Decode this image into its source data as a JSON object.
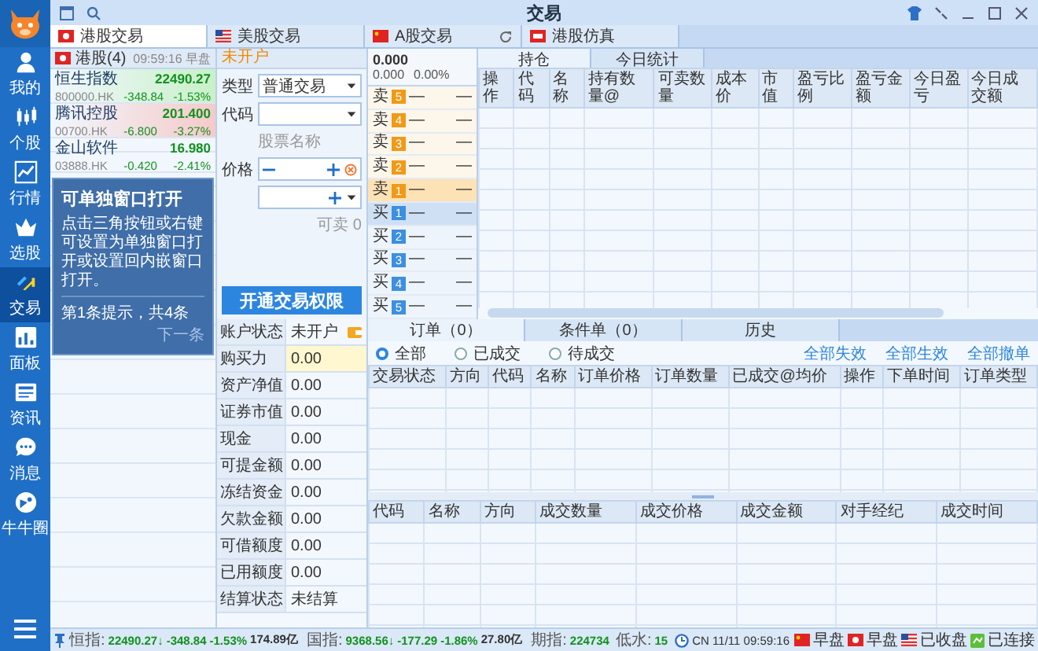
{
  "window": {
    "title": "交易"
  },
  "nav": {
    "items": [
      {
        "kind": "person",
        "label": "我的",
        "selected": false
      },
      {
        "kind": "candles",
        "label": "个股",
        "selected": false
      },
      {
        "kind": "chart",
        "label": "行情",
        "selected": false
      },
      {
        "kind": "crown",
        "label": "选股",
        "selected": false
      },
      {
        "kind": "trade",
        "label": "交易",
        "selected": true
      },
      {
        "kind": "panel",
        "label": "面板",
        "selected": false
      },
      {
        "kind": "news",
        "label": "资讯",
        "selected": false
      },
      {
        "kind": "message",
        "label": "消息",
        "selected": false
      },
      {
        "kind": "community",
        "label": "牛牛圈",
        "selected": false
      }
    ]
  },
  "market_tabs": [
    {
      "kind": "hk",
      "label": "港股交易",
      "selected": true,
      "refresh": false
    },
    {
      "kind": "us",
      "label": "美股交易",
      "selected": false,
      "refresh": false
    },
    {
      "kind": "cn",
      "label": "A股交易",
      "selected": false,
      "refresh": true
    },
    {
      "kind": "sim",
      "label": "港股仿真",
      "selected": false,
      "refresh": false
    }
  ],
  "watchlist": {
    "title": "港股(4)",
    "time": "09:59:16 早盘",
    "rows": [
      {
        "name": "恒生指数",
        "code": "800000.HK",
        "price": "22490.27",
        "change": "-348.84",
        "percent": "-1.53%",
        "color": "#c9f0c9"
      },
      {
        "name": "腾讯控股",
        "code": "00700.HK",
        "price": "201.400",
        "change": "-6.800",
        "percent": "-3.27%",
        "color": "#f5caca"
      },
      {
        "name": "金山软件",
        "code": "03888.HK",
        "price": "16.980",
        "change": "-0.420",
        "percent": "-2.41%"
      }
    ]
  },
  "tooltip": {
    "title": "可单独窗口打开",
    "body": "点击三角按钮或右键可设置为单独窗口打开或设置回内嵌窗口打开。",
    "progress": "第1条提示，共4条",
    "next": "下一条"
  },
  "trade_form": {
    "status": "未开户",
    "type": {
      "label": "类型",
      "value": "普通交易"
    },
    "code": {
      "label": "代码"
    },
    "stock_name": "股票名称",
    "price": {
      "label": "价格"
    },
    "sellable": "可卖 0",
    "button": "开通交易权限"
  },
  "account": {
    "rows": [
      {
        "label": "账户状态",
        "value": "未开户",
        "highlight": false,
        "has_icon": true
      },
      {
        "label": "购买力",
        "value": "0.00",
        "highlight": true,
        "has_icon": false
      },
      {
        "label": "资产净值",
        "value": "0.00",
        "highlight": false,
        "has_icon": false
      },
      {
        "label": "证券市值",
        "value": "0.00",
        "highlight": false,
        "has_icon": false
      },
      {
        "label": "现金",
        "value": "0.00",
        "highlight": false,
        "has_icon": false
      },
      {
        "label": "可提金额",
        "value": "0.00",
        "highlight": false,
        "has_icon": false
      },
      {
        "label": "冻结资金",
        "value": "0.00",
        "highlight": false,
        "has_icon": false
      },
      {
        "label": "欠款金额",
        "value": "0.00",
        "highlight": false,
        "has_icon": false
      },
      {
        "label": "可借额度",
        "value": "0.00",
        "highlight": false,
        "has_icon": false
      },
      {
        "label": "已用额度",
        "value": "0.00",
        "highlight": false,
        "has_icon": false
      },
      {
        "label": "结算状态",
        "value": "未结算",
        "highlight": false,
        "has_icon": false
      }
    ]
  },
  "order_book": {
    "price": "0.000",
    "change": "0.000",
    "percent": "0.00%",
    "levels": [
      {
        "kind": "sell",
        "label": "卖",
        "rank": "5",
        "price": "—",
        "volume": "—",
        "highlight": false
      },
      {
        "kind": "sell",
        "label": "卖",
        "rank": "4",
        "price": "—",
        "volume": "—",
        "highlight": false
      },
      {
        "kind": "sell",
        "label": "卖",
        "rank": "3",
        "price": "—",
        "volume": "—",
        "highlight": false
      },
      {
        "kind": "sell",
        "label": "卖",
        "rank": "2",
        "price": "—",
        "volume": "—",
        "highlight": false
      },
      {
        "kind": "sell",
        "label": "卖",
        "rank": "1",
        "price": "—",
        "volume": "—",
        "highlight": true
      },
      {
        "kind": "buy",
        "label": "买",
        "rank": "1",
        "price": "—",
        "volume": "—",
        "highlight": true
      },
      {
        "kind": "buy",
        "label": "买",
        "rank": "2",
        "price": "—",
        "volume": "—",
        "highlight": false
      },
      {
        "kind": "buy",
        "label": "买",
        "rank": "3",
        "price": "—",
        "volume": "—",
        "highlight": false
      },
      {
        "kind": "buy",
        "label": "买",
        "rank": "4",
        "price": "—",
        "volume": "—",
        "highlight": false
      },
      {
        "kind": "buy",
        "label": "买",
        "rank": "5",
        "price": "—",
        "volume": "—",
        "highlight": false
      }
    ]
  },
  "positions": {
    "tabs": [
      {
        "label": "持仓",
        "selected": true
      },
      {
        "label": "今日统计",
        "selected": false
      }
    ],
    "columns": [
      "操作",
      "代码",
      "名称",
      "持有数量@",
      "可卖数量",
      "成本价",
      "市值",
      "盈亏比例",
      "盈亏金额",
      "今日盈亏",
      "今日成交额"
    ]
  },
  "orders": {
    "tabs": [
      {
        "label": "订单（0）",
        "selected": true
      },
      {
        "label": "条件单（0）",
        "selected": false
      },
      {
        "label": "历史",
        "selected": false
      }
    ],
    "filters": [
      {
        "label": "全部",
        "selected": true
      },
      {
        "label": "已成交",
        "selected": false
      },
      {
        "label": "待成交",
        "selected": false
      }
    ],
    "actions": [
      "全部失效",
      "全部生效",
      "全部撤单"
    ],
    "columns": [
      "交易状态",
      "方向",
      "代码",
      "名称",
      "订单价格",
      "订单数量",
      "已成交@均价",
      "操作",
      "下单时间",
      "订单类型"
    ]
  },
  "trades": {
    "columns": [
      "代码",
      "名称",
      "方向",
      "成交数量",
      "成交价格",
      "成交金额",
      "对手经纪",
      "成交时间"
    ]
  },
  "status_bar": {
    "indices": [
      {
        "label": "恒指:",
        "value": "22490.27↓",
        "change": "-348.84",
        "percent": "-1.53%",
        "turnover": "174.89亿"
      },
      {
        "label": "国指:",
        "value": "9368.56↓",
        "change": "-177.29",
        "percent": "-1.86%",
        "turnover": "27.80亿"
      }
    ],
    "quotes": [
      {
        "label": "期指:",
        "value": "224734"
      },
      {
        "label": "低水:",
        "value": "15"
      }
    ],
    "clock": "CN 11/11 09:59:16",
    "markets": [
      {
        "kind": "cn",
        "label": "早盘"
      },
      {
        "kind": "hk",
        "label": "早盘"
      },
      {
        "kind": "us",
        "label": "已收盘"
      }
    ],
    "connection": "已连接"
  }
}
